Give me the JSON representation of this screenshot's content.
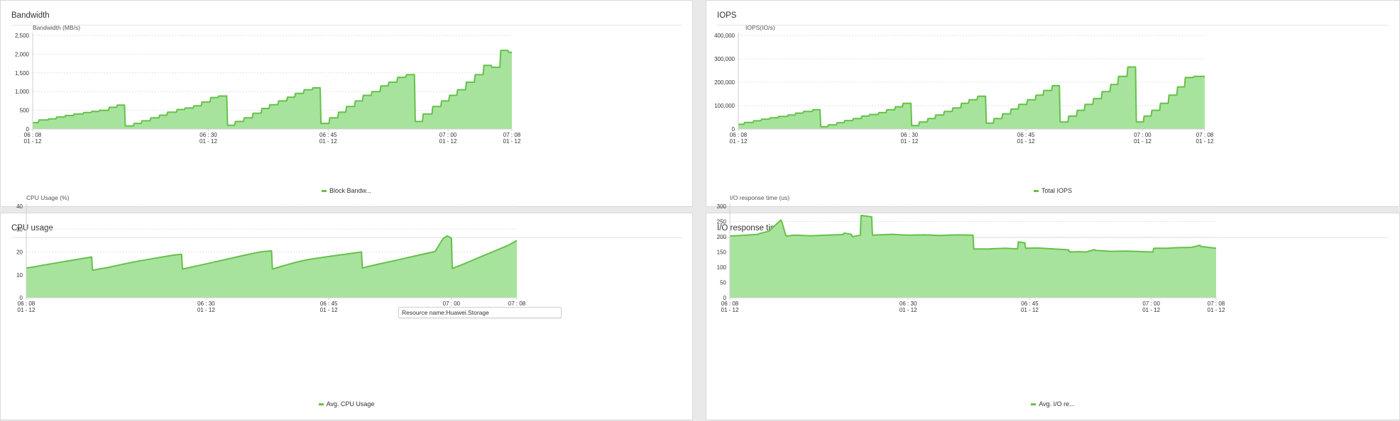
{
  "colors": {
    "fill": "#a8e39e",
    "line": "#64c247",
    "grid": "#e2e2e2",
    "axis": "#cfcfcf"
  },
  "tooltip": {
    "text": "Resource name:Huawei.Storage"
  },
  "x_axis": {
    "domain": [
      0,
      60
    ],
    "ticks": [
      {
        "value": 0,
        "time": "06 : 08",
        "date": "01 - 12"
      },
      {
        "value": 22,
        "time": "06 : 30",
        "date": "01 - 12"
      },
      {
        "value": 37,
        "time": "06 : 45",
        "date": "01 - 12"
      },
      {
        "value": 52,
        "time": "07 : 00",
        "date": "01 - 12"
      },
      {
        "value": 60,
        "time": "07 : 08",
        "date": "01 - 12"
      }
    ]
  },
  "panels": [
    {
      "title": "Bandwidth"
    },
    {
      "title": "IOPS"
    },
    {
      "title": "CPU usage"
    },
    {
      "title": "I/O response time"
    }
  ],
  "chart_data": [
    {
      "type": "area",
      "title": "Bandwidth",
      "ylabel": "Bandwidth (MB/s)",
      "ylim": [
        0,
        2500
      ],
      "yticks": [
        0,
        500,
        1000,
        1500,
        2000,
        2500
      ],
      "ytick_labels": [
        "0",
        "500",
        "1,000",
        "1,500",
        "2,000",
        "2,500"
      ],
      "grid": true,
      "legend": "bottom",
      "series": [
        {
          "name": "Block Bandw...",
          "x": [
            0,
            0.7,
            0.8,
            1.9,
            2.0,
            2.9,
            3.0,
            4.0,
            4.1,
            5.1,
            5.2,
            6.3,
            6.4,
            7.3,
            7.4,
            8.3,
            8.4,
            9.5,
            9.6,
            10.5,
            10.6,
            11.5,
            11.6,
            12.6,
            12.7,
            13.6,
            13.7,
            14.7,
            14.8,
            15.8,
            15.9,
            16.8,
            16.9,
            18.0,
            18.1,
            19.0,
            19.1,
            20.1,
            20.2,
            21.1,
            21.2,
            22.2,
            22.3,
            23.2,
            23.3,
            24.3,
            24.4,
            25.3,
            25.4,
            26.4,
            26.5,
            27.5,
            27.6,
            28.6,
            28.7,
            29.6,
            29.7,
            30.7,
            30.8,
            31.8,
            31.9,
            32.8,
            32.9,
            33.9,
            34.0,
            35.0,
            35.1,
            36.0,
            36.1,
            37.1,
            37.2,
            38.2,
            38.3,
            39.2,
            39.3,
            40.3,
            40.4,
            41.3,
            41.4,
            42.4,
            42.5,
            43.5,
            43.6,
            44.5,
            44.6,
            45.6,
            45.7,
            46.7,
            46.8,
            47.8,
            47.9,
            48.8,
            48.9,
            50.0,
            50.1,
            51.1,
            51.2,
            52.1,
            52.2,
            53.1,
            53.2,
            54.2,
            54.3,
            55.3,
            55.4,
            56.4,
            56.5,
            57.4,
            57.5,
            58.5,
            58.6,
            59.5,
            59.6,
            60
          ],
          "y": [
            170,
            170,
            240,
            240,
            270,
            270,
            320,
            320,
            360,
            360,
            400,
            400,
            440,
            440,
            470,
            470,
            500,
            500,
            580,
            580,
            640,
            640,
            80,
            80,
            150,
            150,
            220,
            220,
            300,
            300,
            370,
            370,
            450,
            450,
            520,
            520,
            560,
            560,
            620,
            620,
            720,
            720,
            840,
            840,
            880,
            880,
            100,
            100,
            200,
            200,
            300,
            300,
            420,
            420,
            550,
            550,
            650,
            650,
            750,
            750,
            850,
            850,
            950,
            950,
            1050,
            1050,
            1100,
            1100,
            150,
            150,
            300,
            300,
            450,
            450,
            600,
            600,
            750,
            750,
            900,
            900,
            1000,
            1000,
            1150,
            1150,
            1250,
            1250,
            1380,
            1380,
            1450,
            1450,
            200,
            200,
            400,
            400,
            600,
            600,
            750,
            750,
            900,
            900,
            1050,
            1050,
            1250,
            1250,
            1450,
            1450,
            1700,
            1700,
            1650,
            1650,
            2100,
            2100,
            2050,
            2050
          ]
        }
      ]
    },
    {
      "type": "area",
      "title": "IOPS",
      "ylabel": "IOPS(IO/s)",
      "ylim": [
        0,
        400000
      ],
      "yticks": [
        0,
        100000,
        200000,
        300000,
        400000
      ],
      "ytick_labels": [
        "0",
        "100,000",
        "200,000",
        "300,000",
        "400,000"
      ],
      "grid": true,
      "legend": "bottom",
      "series": [
        {
          "name": "Total IOPS",
          "x": [
            0,
            0.7,
            0.8,
            1.9,
            2.0,
            2.9,
            3.0,
            4.0,
            4.1,
            5.1,
            5.2,
            6.3,
            6.4,
            7.3,
            7.4,
            8.3,
            8.4,
            9.5,
            9.6,
            10.5,
            10.6,
            11.5,
            11.6,
            12.6,
            12.7,
            13.6,
            13.7,
            14.7,
            14.8,
            15.8,
            15.9,
            16.8,
            16.9,
            18.0,
            18.1,
            19.0,
            19.1,
            20.1,
            20.2,
            21.1,
            21.2,
            22.2,
            22.3,
            23.2,
            23.3,
            24.3,
            24.4,
            25.3,
            25.4,
            26.4,
            26.5,
            27.5,
            27.6,
            28.6,
            28.7,
            29.6,
            29.7,
            30.7,
            30.8,
            31.8,
            31.9,
            32.8,
            32.9,
            33.9,
            34.0,
            35.0,
            35.1,
            36.0,
            36.1,
            37.1,
            37.2,
            38.2,
            38.3,
            39.2,
            39.3,
            40.3,
            40.4,
            41.3,
            41.4,
            42.4,
            42.5,
            43.5,
            43.6,
            44.5,
            44.6,
            45.6,
            45.7,
            46.7,
            46.8,
            47.8,
            47.9,
            48.8,
            48.9,
            50.0,
            50.1,
            51.1,
            51.2,
            52.1,
            52.2,
            53.1,
            53.2,
            54.2,
            54.3,
            55.3,
            55.4,
            56.4,
            56.5,
            57.4,
            57.5,
            58.5,
            58.6,
            59.5,
            59.6,
            60
          ],
          "y": [
            20000,
            20000,
            28000,
            28000,
            35000,
            35000,
            42000,
            42000,
            48000,
            48000,
            54000,
            54000,
            60000,
            60000,
            68000,
            68000,
            75000,
            75000,
            82000,
            82000,
            10000,
            10000,
            18000,
            18000,
            27000,
            27000,
            36000,
            36000,
            45000,
            45000,
            55000,
            55000,
            62000,
            62000,
            70000,
            70000,
            82000,
            82000,
            95000,
            95000,
            110000,
            110000,
            15000,
            15000,
            30000,
            30000,
            45000,
            45000,
            60000,
            60000,
            75000,
            75000,
            90000,
            90000,
            110000,
            110000,
            125000,
            125000,
            140000,
            140000,
            25000,
            25000,
            45000,
            45000,
            65000,
            65000,
            85000,
            85000,
            105000,
            105000,
            125000,
            125000,
            145000,
            145000,
            165000,
            165000,
            185000,
            185000,
            30000,
            30000,
            55000,
            55000,
            80000,
            80000,
            105000,
            105000,
            130000,
            130000,
            160000,
            160000,
            190000,
            190000,
            225000,
            225000,
            265000,
            265000,
            30000,
            30000,
            55000,
            55000,
            80000,
            80000,
            110000,
            110000,
            145000,
            145000,
            180000,
            180000,
            220000,
            220000,
            225000,
            225000,
            225000,
            225000
          ]
        }
      ]
    },
    {
      "type": "area",
      "title": "CPU usage",
      "ylabel": "CPU Usage (%)",
      "ylim": [
        0,
        40
      ],
      "yticks": [
        0,
        10,
        20,
        30,
        40
      ],
      "ytick_labels": [
        "0",
        "10",
        "20",
        "30",
        "40"
      ],
      "grid": true,
      "legend": "bottom",
      "series": [
        {
          "name": "Avg. CPU Usage",
          "x": [
            0,
            1,
            2,
            3,
            4,
            5,
            6,
            7,
            8,
            8.1,
            9,
            10,
            11,
            12,
            13,
            14,
            15,
            16,
            17,
            18,
            19,
            19.1,
            20,
            21,
            22,
            23,
            24,
            25,
            26,
            27,
            28,
            29,
            30,
            30.1,
            31,
            32,
            33,
            34,
            35,
            36,
            37,
            38,
            39,
            40,
            41,
            41.1,
            42,
            43,
            44,
            45,
            46,
            47,
            48,
            49,
            50,
            51,
            51.5,
            52,
            52.1,
            53,
            54,
            55,
            56,
            57,
            58,
            59,
            60
          ],
          "y": [
            13,
            13.5,
            14.2,
            14.8,
            15.4,
            16,
            16.6,
            17.2,
            17.8,
            12,
            12.6,
            13.2,
            14,
            14.8,
            15.5,
            16.2,
            16.8,
            17.4,
            18,
            18.6,
            19,
            12.5,
            13.2,
            14,
            14.8,
            15.6,
            16.4,
            17.2,
            18,
            18.8,
            19.6,
            20.2,
            20.5,
            12.5,
            13.5,
            14.5,
            15.5,
            16.3,
            17,
            17.5,
            18,
            18.5,
            19,
            19.5,
            20,
            13,
            13.8,
            14.6,
            15.4,
            16.2,
            17,
            17.8,
            18.6,
            19.4,
            20.2,
            26,
            27,
            26,
            12.8,
            14,
            15.5,
            17,
            18.5,
            20,
            21.5,
            23,
            25
          ]
        }
      ]
    },
    {
      "type": "area",
      "title": "I/O response time",
      "ylabel": "I/O response time (us)",
      "ylim": [
        0,
        300
      ],
      "yticks": [
        0,
        50,
        100,
        150,
        200,
        250,
        300
      ],
      "ytick_labels": [
        "0",
        "50",
        "100",
        "150",
        "200",
        "250",
        "300"
      ],
      "grid": true,
      "legend": "bottom",
      "series": [
        {
          "name": "Avg. I/O re...",
          "x": [
            0,
            2,
            3.5,
            3.6,
            4.8,
            4.9,
            6.3,
            6.4,
            6.9,
            7.0,
            8,
            10,
            12,
            14,
            14.1,
            15,
            15.1,
            16.1,
            16.2,
            17.5,
            17.6,
            20,
            22,
            24,
            26,
            28,
            30,
            30.1,
            32,
            34,
            35.5,
            35.6,
            36.4,
            36.5,
            38,
            40,
            41.8,
            41.9,
            43,
            44,
            45,
            45.1,
            47,
            49,
            51,
            52.2,
            52.3,
            54,
            55,
            57,
            58,
            58.1,
            60
          ],
          "y": [
            202,
            205,
            208,
            210,
            218,
            220,
            255,
            250,
            205,
            202,
            205,
            203,
            205,
            207,
            212,
            208,
            200,
            205,
            270,
            265,
            205,
            208,
            205,
            206,
            204,
            206,
            205,
            160,
            160,
            162,
            160,
            183,
            180,
            162,
            163,
            160,
            157,
            150,
            151,
            150,
            158,
            155,
            152,
            153,
            151,
            150,
            162,
            162,
            164,
            165,
            172,
            168,
            162
          ]
        }
      ]
    }
  ]
}
